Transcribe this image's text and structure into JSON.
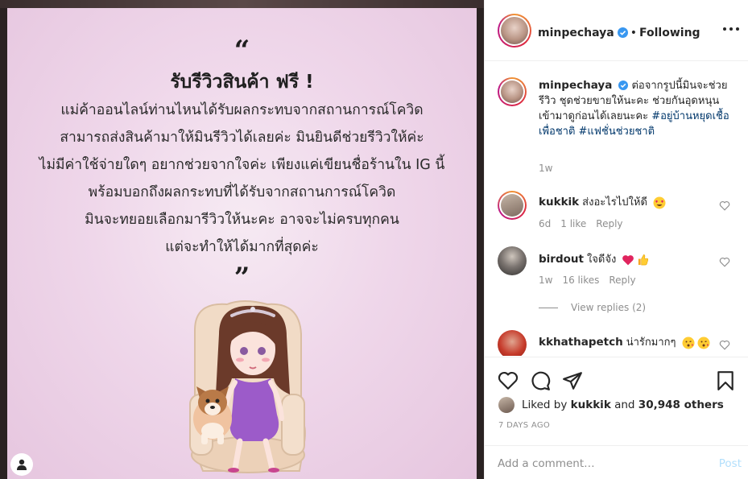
{
  "post_image": {
    "quote_open": "“",
    "heading": "รับรีวิวสินค้า ฟรี !",
    "lines": [
      "แม่ค้าออนไลน์ท่านไหนได้รับผลกระทบจากสถานการณ์โควิด",
      "สามารถส่งสินค้ามาให้มินรีวิวได้เลยค่ะ มินยินดีช่วยรีวิวให้ค่ะ",
      "ไม่มีค่าใช้จ่ายใดๆ อยากช่วยจากใจค่ะ เพียงแค่เขียนชื่อร้านใน IG นี้",
      "พร้อมบอกถึงผลกระทบที่ได้รับจากสถานการณ์โควิด",
      "มินจะทยอยเลือกมารีวิวให้นะคะ อาจจะไม่ครบทุกคน",
      "แต่จะทำให้ได้มากที่สุดค่ะ"
    ],
    "quote_close": "”"
  },
  "header": {
    "username": "minpechaya",
    "separator": "•",
    "follow_status": "Following"
  },
  "caption": {
    "username": "minpechaya",
    "text": "ต่อจากรูปนี้มินจะช่วยรีวิว ชุดช่วยขายให้นะคะ ช่วยกันอุดหนุน เข้ามาดูก่อนได้เลยนะคะ",
    "hashtags": "#อยู่บ้านหยุดเชื้อเพื่อชาติ #แฟชั่นช่วยชาติ",
    "time": "1w"
  },
  "comments": [
    {
      "username": "kukkik",
      "text": "ส่งอะไรไปให้ดี",
      "emoji": "heart-eyes-emoji",
      "time": "6d",
      "likes": "1 like",
      "reply": "Reply"
    },
    {
      "username": "birdout",
      "text": "ใจดีจัง",
      "emoji": "heart-thumbsup-emoji",
      "time": "1w",
      "likes": "16 likes",
      "reply": "Reply",
      "view_replies": "View replies (2)"
    },
    {
      "username": "kkhathapetch",
      "text": "น่ารักมากๆ",
      "emoji": "kiss-emoji"
    }
  ],
  "likes": {
    "prefix": "Liked by",
    "user": "kukkik",
    "middle": "and",
    "count": "30,948 others"
  },
  "date": "7 DAYS AGO",
  "add_comment": {
    "placeholder": "Add a comment…",
    "post_label": "Post"
  },
  "colors": {
    "accent": "#0095f6",
    "post_disabled": "#b2dffc",
    "verified": "#3897f0",
    "hashtag": "#00376b",
    "like_heart": "#ed4956",
    "image_bg": "#efd7ea"
  }
}
